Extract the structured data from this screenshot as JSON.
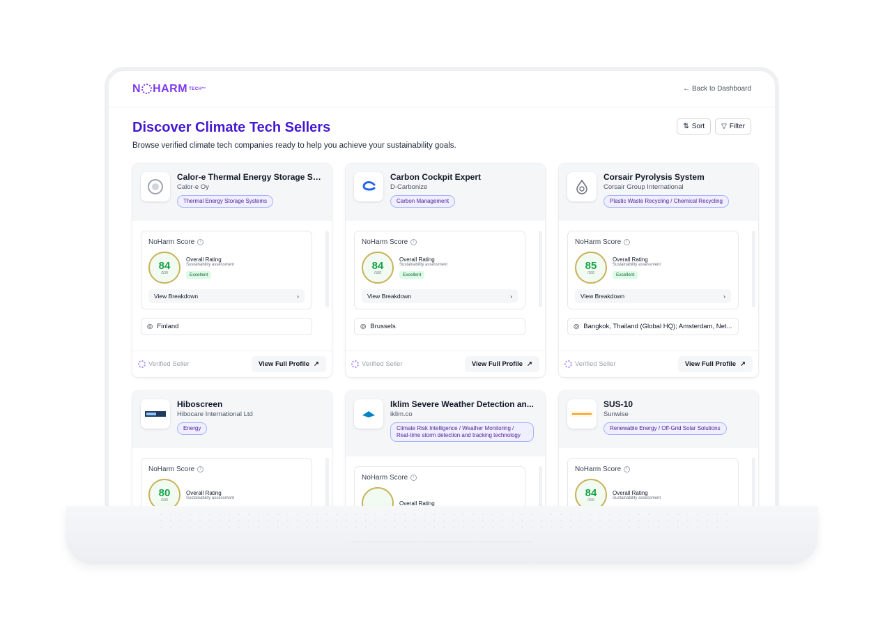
{
  "header": {
    "logo_text": "NOHARM",
    "logo_mark": "TECH™",
    "back_label": "← Back to Dashboard"
  },
  "page": {
    "title": "Discover Climate Tech Sellers",
    "subtitle": "Browse verified climate tech companies ready to help you achieve your sustainability goals.",
    "sort_label": "Sort",
    "filter_label": "Filter"
  },
  "common": {
    "score_label": "NoHarm Score",
    "overall_rating": "Overall Rating",
    "sustainability": "Sustainability assessment",
    "excellent": "Excellent",
    "view_breakdown": "View Breakdown",
    "verified_seller": "Verified Seller",
    "view_profile": "View Full Profile",
    "out_of": "/100"
  },
  "cards": [
    {
      "name": "Calor-e Thermal Energy Storage Sy...",
      "company": "Calor-e Oy",
      "tag": "Thermal Energy Storage Systems",
      "score": "84",
      "location": "Finland"
    },
    {
      "name": "Carbon Cockpit Expert",
      "company": "D-Carbonize",
      "tag": "Carbon Management",
      "score": "84",
      "location": "Brussels"
    },
    {
      "name": "Corsair Pyrolysis System",
      "company": "Corsair Group International",
      "tag": "Plastic Waste Recycling / Chemical Recycling",
      "score": "85",
      "location": "Bangkok, Thailand (Global HQ); Amsterdam, Net..."
    },
    {
      "name": "Hiboscreen",
      "company": "Hibocare International Ltd",
      "tag": "Energy",
      "score": "80",
      "location": ""
    },
    {
      "name": "Iklim Severe Weather Detection an...",
      "company": "iklim.co",
      "tag": "Climate Risk Intelligence / Weather Monitoring / Real-time storm detection and tracking technology",
      "score": "",
      "location": ""
    },
    {
      "name": "SUS-10",
      "company": "Sunwise",
      "tag": "Renewable Energy / Off-Grid Solar Solutions",
      "score": "84",
      "location": ""
    }
  ],
  "colors": {
    "brand": "#7c3aed",
    "title": "#4318d1",
    "score_green": "#16a34a"
  }
}
